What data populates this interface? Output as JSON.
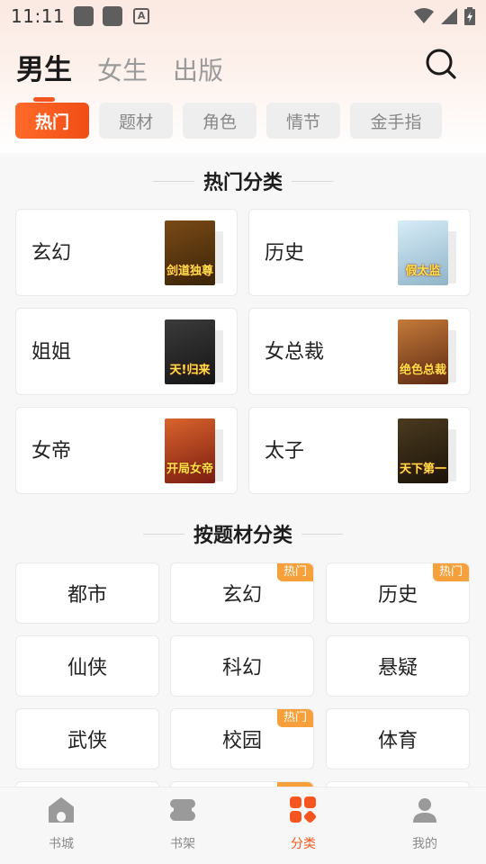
{
  "status": {
    "time": "11:11"
  },
  "top_tabs": [
    {
      "label": "男生",
      "active": true
    },
    {
      "label": "女生",
      "active": false
    },
    {
      "label": "出版",
      "active": false
    }
  ],
  "chips": [
    {
      "label": "热门",
      "active": true
    },
    {
      "label": "题材",
      "active": false
    },
    {
      "label": "角色",
      "active": false
    },
    {
      "label": "情节",
      "active": false
    },
    {
      "label": "金手指",
      "active": false
    }
  ],
  "hot_section": {
    "title": "热门分类",
    "items": [
      {
        "name": "玄幻",
        "cover_text": "剑道独尊",
        "cover_colors": [
          "#7a4a16",
          "#3a2408"
        ]
      },
      {
        "name": "历史",
        "cover_text": "假太监",
        "cover_colors": [
          "#d7ecf7",
          "#8fb4c9"
        ]
      },
      {
        "name": "姐姐",
        "cover_text": "天!归来",
        "cover_colors": [
          "#3b3b3b",
          "#151515"
        ]
      },
      {
        "name": "女总裁",
        "cover_text": "绝色总裁",
        "cover_colors": [
          "#c47a3a",
          "#5e2a12"
        ]
      },
      {
        "name": "女帝",
        "cover_text": "开局女帝",
        "cover_colors": [
          "#d9642d",
          "#7a1c10"
        ]
      },
      {
        "name": "太子",
        "cover_text": "天下第一",
        "cover_colors": [
          "#4a3a20",
          "#1c1408"
        ]
      }
    ]
  },
  "topic_section": {
    "title": "按题材分类",
    "hot_label": "热门",
    "items": [
      {
        "name": "都市",
        "hot": false
      },
      {
        "name": "玄幻",
        "hot": true
      },
      {
        "name": "历史",
        "hot": true
      },
      {
        "name": "仙侠",
        "hot": false
      },
      {
        "name": "科幻",
        "hot": false
      },
      {
        "name": "悬疑",
        "hot": false
      },
      {
        "name": "武侠",
        "hot": false
      },
      {
        "name": "校园",
        "hot": true
      },
      {
        "name": "体育",
        "hot": false
      }
    ]
  },
  "bottom_nav": [
    {
      "label": "书城",
      "icon": "home-icon",
      "active": false
    },
    {
      "label": "书架",
      "icon": "bookshelf-icon",
      "active": false
    },
    {
      "label": "分类",
      "icon": "category-icon",
      "active": true
    },
    {
      "label": "我的",
      "icon": "profile-icon",
      "active": false
    }
  ],
  "colors": {
    "accent": "#f5561f",
    "hot_badge": "#f5a03a"
  }
}
